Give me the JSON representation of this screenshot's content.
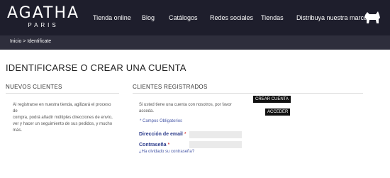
{
  "brand": {
    "name": "AGATHA",
    "sub": "PARIS"
  },
  "nav": {
    "items": [
      {
        "label": "Tienda online"
      },
      {
        "label": "Blog"
      },
      {
        "label": "Catálogos"
      },
      {
        "label": "Redes sociales"
      },
      {
        "label": "Tiendas"
      },
      {
        "label": "Distribuya nuestra marca"
      }
    ]
  },
  "breadcrumb": "Inicio > Identificate",
  "page": {
    "title": "IDENTIFICARSE O CREAR UNA CUENTA"
  },
  "new_clients": {
    "title": "NUEVOS CLIENTES",
    "text": [
      "Al registrarse en nuestra tienda, agilizará el proceso de",
      "compra, podrá añadir múltiples direcciones de envío,",
      "ver y hacer un seguimiento de sus pedidos, y mucho",
      "más."
    ],
    "create_button": "CREAR CUENTA"
  },
  "registered": {
    "title": "CLIENTES REGISTRADOS",
    "text": [
      "Si usted tiene una cuenta con nosotros, por favor",
      "acceda."
    ],
    "required_note": "* Campos Obligatorios",
    "email_label": "Dirección de email",
    "password_label": "Contraseña",
    "star": "*",
    "forgot": "¿Ha olvidado su contraseña?",
    "login_button": "ACCEDER"
  },
  "colors": {
    "topbar": "#1e1e2c",
    "crumbbar": "#2e2e3c",
    "link": "#4a5aa8",
    "label": "#2a3a8a"
  },
  "icons": {
    "logo_dog": "scottish-terrier-icon"
  }
}
